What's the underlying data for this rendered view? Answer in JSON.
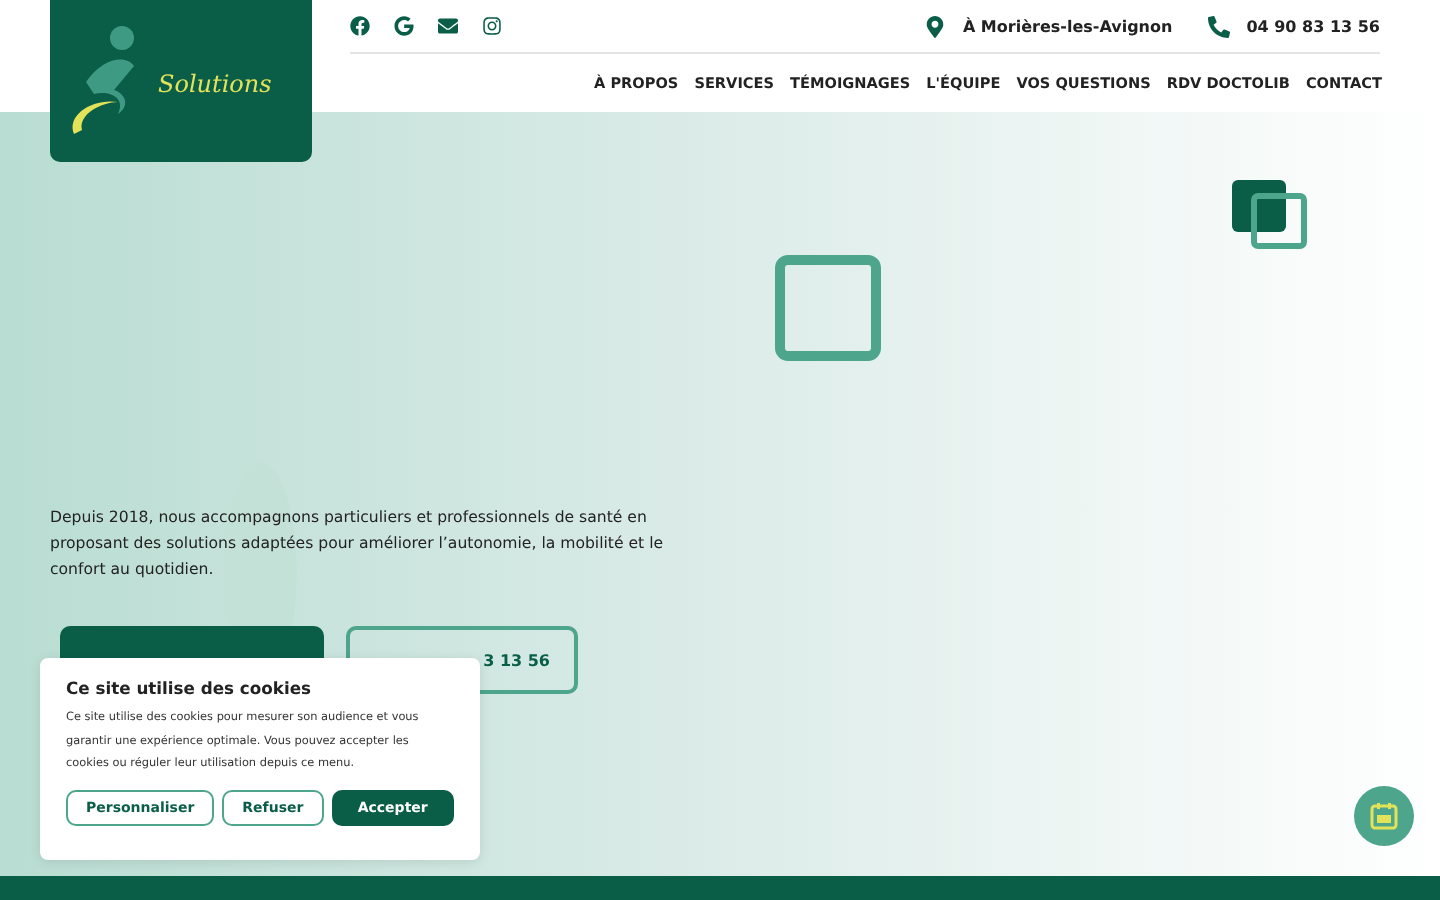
{
  "logo": {
    "text": "Solutions"
  },
  "contact": {
    "location": "À Morières-les-Avignon",
    "phone": "04 90 83 13 56"
  },
  "nav": [
    "À PROPOS",
    "SERVICES",
    "TÉMOIGNAGES",
    "L'ÉQUIPE",
    "VOS QUESTIONS",
    "RDV DOCTOLIB",
    "CONTACT"
  ],
  "hero": {
    "text": "Depuis 2018, nous accompagnons particuliers et professionnels de santé en proposant des solutions adaptées pour améliorer l’autonomie, la mobilité et le confort au quotidien.",
    "phone_button": "3 13 56"
  },
  "cookie_banner": {
    "title": "Ce site utilise des cookies",
    "text": "Ce site utilise des cookies pour mesurer son audience et vous garantir une expérience optimale. Vous pouvez accepter les cookies ou réguler leur utilisation depuis ce menu.",
    "buttons": [
      {
        "label": "Personnaliser",
        "kind": "outline"
      },
      {
        "label": "Refuser",
        "kind": "outline"
      },
      {
        "label": "Accepter",
        "kind": "filled"
      }
    ]
  }
}
